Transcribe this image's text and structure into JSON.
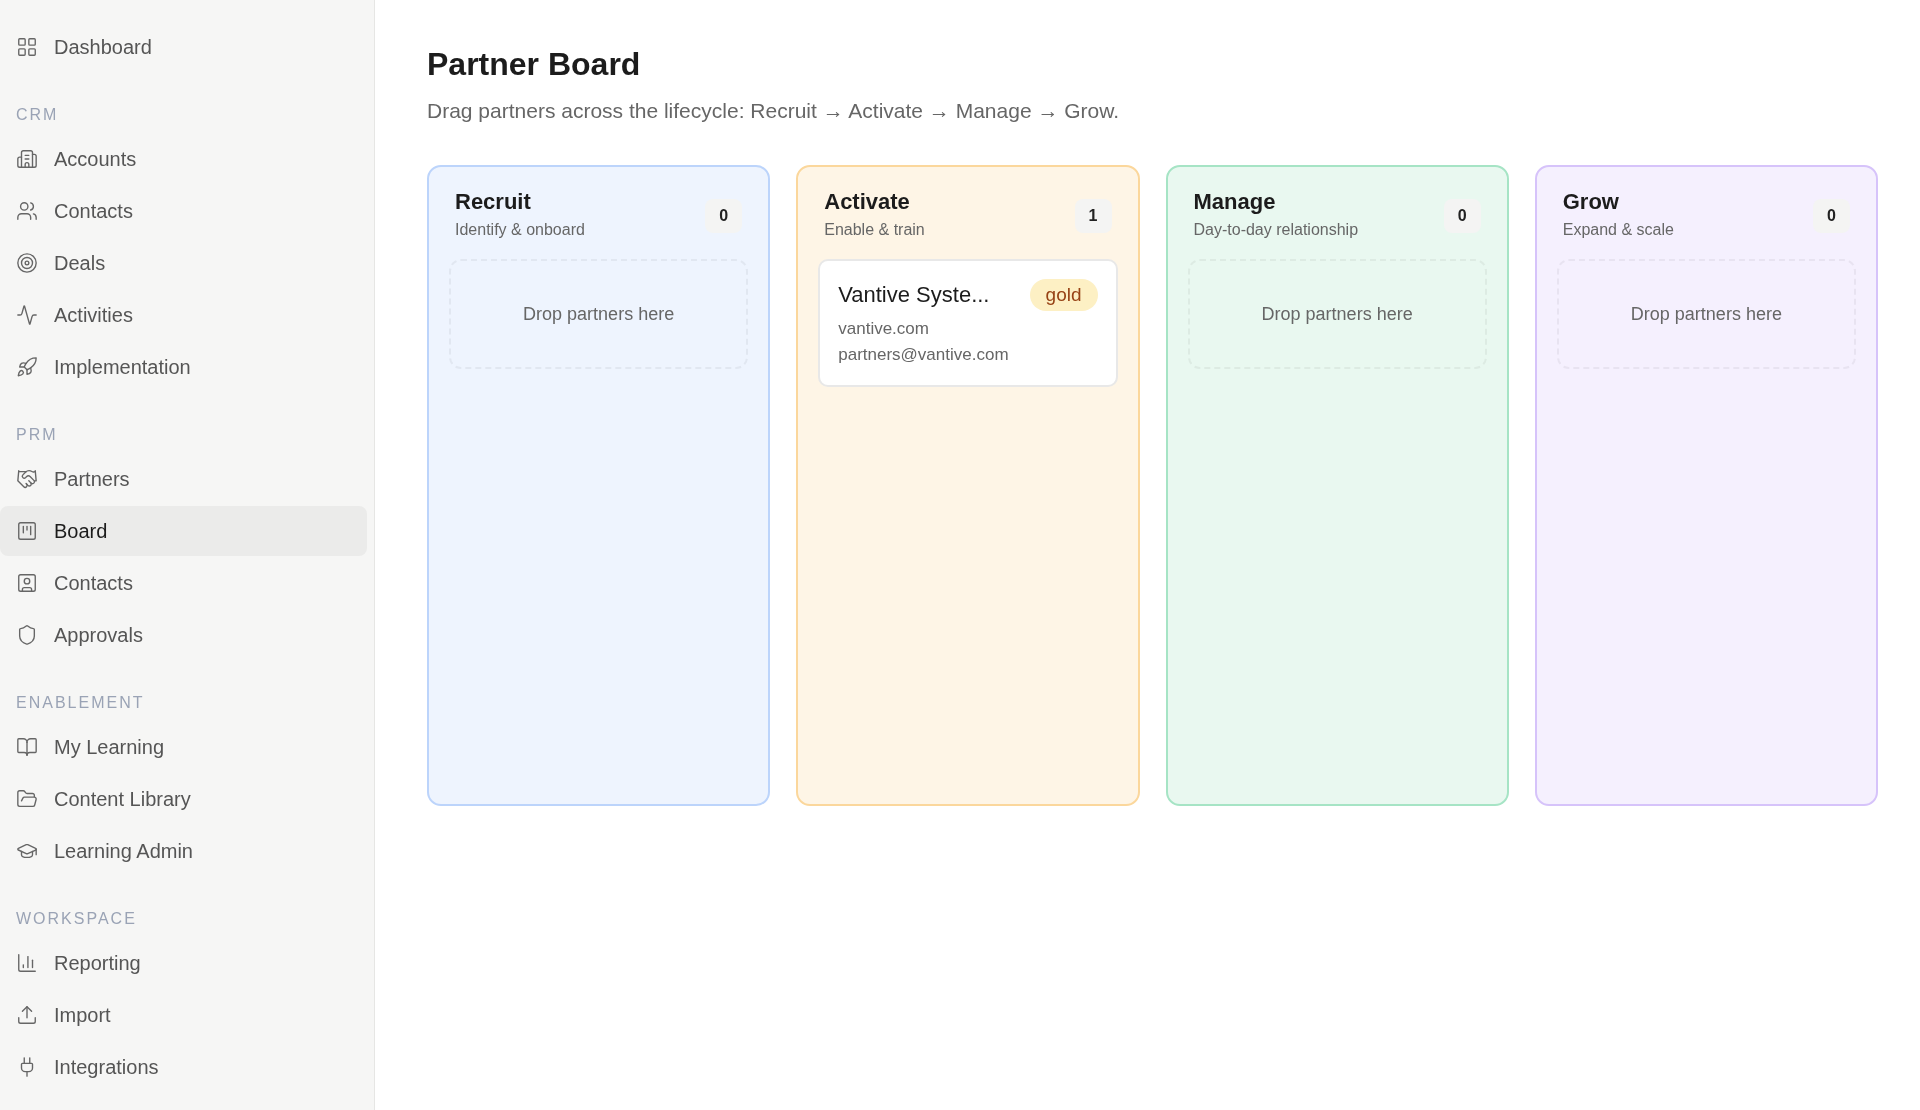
{
  "sidebar": {
    "items": [
      {
        "label": "Dashboard",
        "kind": "grid",
        "selected": false
      }
    ],
    "sections": [
      {
        "title": "CRM",
        "items": [
          {
            "label": "Accounts",
            "kind": "building",
            "selected": false
          },
          {
            "label": "Contacts",
            "kind": "users",
            "selected": false
          },
          {
            "label": "Deals",
            "kind": "target",
            "selected": false
          },
          {
            "label": "Activities",
            "kind": "pulse",
            "selected": false
          },
          {
            "label": "Implementation",
            "kind": "rocket",
            "selected": false
          }
        ]
      },
      {
        "title": "PRM",
        "items": [
          {
            "label": "Partners",
            "kind": "handshake",
            "selected": false
          },
          {
            "label": "Board",
            "kind": "kanban",
            "selected": true
          },
          {
            "label": "Contacts",
            "kind": "contact",
            "selected": false
          },
          {
            "label": "Approvals",
            "kind": "shield",
            "selected": false
          }
        ]
      },
      {
        "title": "ENABLEMENT",
        "items": [
          {
            "label": "My Learning",
            "kind": "book",
            "selected": false
          },
          {
            "label": "Content Library",
            "kind": "folder",
            "selected": false
          },
          {
            "label": "Learning Admin",
            "kind": "cap",
            "selected": false
          }
        ]
      },
      {
        "title": "WORKSPACE",
        "items": [
          {
            "label": "Reporting",
            "kind": "chart",
            "selected": false
          },
          {
            "label": "Import",
            "kind": "upload",
            "selected": false
          },
          {
            "label": "Integrations",
            "kind": "plug",
            "selected": false
          }
        ]
      }
    ]
  },
  "page": {
    "title": "Partner Board",
    "subtitle": "Drag partners across the lifecycle: Recruit → Activate → Manage → Grow."
  },
  "columns": [
    {
      "title": "Recruit",
      "subtitle": "Identify & onboard",
      "count": "0",
      "color": "#bcd4fb",
      "empty_text": "Drop partners here"
    },
    {
      "title": "Activate",
      "subtitle": "Enable & train",
      "count": "1",
      "color": "#fbd79c",
      "cards": [
        {
          "name": "Vantive Syste...",
          "tier": "gold",
          "domain": "vantive.com",
          "email": "partners@vantive.com"
        }
      ]
    },
    {
      "title": "Manage",
      "subtitle": "Day-to-day relationship",
      "count": "0",
      "color": "#a6e4c5",
      "empty_text": "Drop partners here"
    },
    {
      "title": "Grow",
      "subtitle": "Expand & scale",
      "count": "0",
      "color": "#d6c3fa",
      "empty_text": "Drop partners here"
    }
  ]
}
